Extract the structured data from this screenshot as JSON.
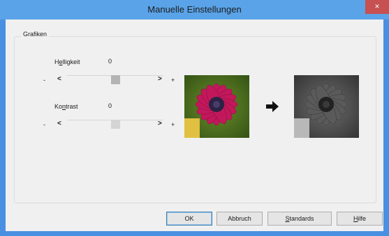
{
  "window": {
    "title": "Manuelle Einstellungen",
    "close_glyph": "×"
  },
  "group": {
    "legend": "Grafiken"
  },
  "brightness": {
    "label_pre": "H",
    "label_ul": "e",
    "label_post": "lligkeit",
    "value": "0",
    "minus": "-",
    "plus": "+",
    "left_arrow": "<",
    "right_arrow": ">",
    "level": 0.5
  },
  "contrast": {
    "label_pre": "Ko",
    "label_ul": "n",
    "label_post": "trast",
    "value": "0",
    "minus": "-",
    "plus": "+",
    "left_arrow": "<",
    "right_arrow": ">",
    "level": 0.5,
    "disabled": true
  },
  "preview": {
    "original_image": "pink-daisy-photo",
    "result_image": "grayscale-daisy-photo",
    "arrow_icon": "right-arrow-icon"
  },
  "buttons": {
    "ok": "OK",
    "cancel": "Abbruch",
    "defaults_ul": "S",
    "defaults_post": "tandards",
    "help_ul": "H",
    "help_post": "ilfe"
  },
  "colors": {
    "titlebar": "#5aa3e8",
    "close": "#c75050",
    "flower": "#c2185b"
  }
}
